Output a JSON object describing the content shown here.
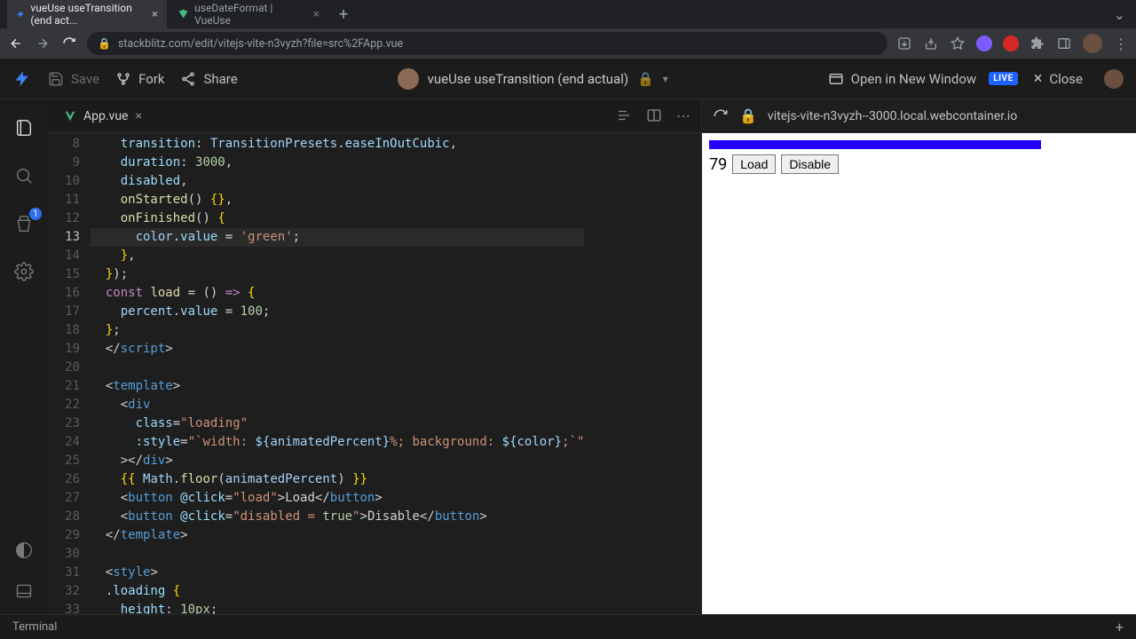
{
  "browser": {
    "tabs": [
      {
        "title": "vueUse useTransition (end act...",
        "active": true
      },
      {
        "title": "useDateFormat | VueUse",
        "active": false
      }
    ],
    "url": "stackblitz.com/edit/vitejs-vite-n3vyzh?file=src%2FApp.vue"
  },
  "app_bar": {
    "save": "Save",
    "fork": "Fork",
    "share": "Share",
    "project_title": "vueUse useTransition (end actual)",
    "open_new_window": "Open in New Window",
    "live": "LIVE",
    "close": "Close"
  },
  "activity": {
    "badge": "1"
  },
  "editor": {
    "filename": "App.vue",
    "line_start": 8,
    "line_end": 33,
    "highlight_line": 13,
    "lines": [
      {
        "n": 8,
        "segs": [
          [
            "    ",
            ""
          ],
          [
            "transition",
            "prop"
          ],
          [
            ": ",
            ""
          ],
          [
            "TransitionPresets",
            "var"
          ],
          [
            ".",
            ""
          ],
          [
            "easeInOutCubic",
            "prop"
          ],
          [
            ",",
            ""
          ]
        ]
      },
      {
        "n": 9,
        "segs": [
          [
            "    ",
            ""
          ],
          [
            "duration",
            "prop"
          ],
          [
            ": ",
            ""
          ],
          [
            "3000",
            "num"
          ],
          [
            ",",
            ""
          ]
        ]
      },
      {
        "n": 10,
        "segs": [
          [
            "    ",
            ""
          ],
          [
            "disabled",
            "prop"
          ],
          [
            ",",
            ""
          ]
        ]
      },
      {
        "n": 11,
        "segs": [
          [
            "    ",
            ""
          ],
          [
            "onStarted",
            "fn"
          ],
          [
            "() ",
            ""
          ],
          [
            "{}",
            "brace"
          ],
          [
            ",",
            ""
          ]
        ]
      },
      {
        "n": 12,
        "segs": [
          [
            "    ",
            ""
          ],
          [
            "onFinished",
            "fn"
          ],
          [
            "() ",
            ""
          ],
          [
            "{",
            "brace"
          ]
        ]
      },
      {
        "n": 13,
        "segs": [
          [
            "      ",
            ""
          ],
          [
            "color",
            "var"
          ],
          [
            ".",
            ""
          ],
          [
            "value",
            "prop"
          ],
          [
            " = ",
            ""
          ],
          [
            "'green'",
            "str"
          ],
          [
            ";",
            ""
          ]
        ]
      },
      {
        "n": 14,
        "segs": [
          [
            "    ",
            ""
          ],
          [
            "}",
            "brace"
          ],
          [
            ",",
            ""
          ]
        ]
      },
      {
        "n": 15,
        "segs": [
          [
            "  ",
            ""
          ],
          [
            "}",
            "brace"
          ],
          [
            ");",
            ""
          ]
        ]
      },
      {
        "n": 16,
        "segs": [
          [
            "  ",
            ""
          ],
          [
            "const",
            "kw"
          ],
          [
            " ",
            ""
          ],
          [
            "load",
            "fn"
          ],
          [
            " = () ",
            ""
          ],
          [
            "=>",
            "kw"
          ],
          [
            " ",
            ""
          ],
          [
            "{",
            "brace"
          ]
        ]
      },
      {
        "n": 17,
        "segs": [
          [
            "    ",
            ""
          ],
          [
            "percent",
            "var"
          ],
          [
            ".",
            ""
          ],
          [
            "value",
            "prop"
          ],
          [
            " = ",
            ""
          ],
          [
            "100",
            "num"
          ],
          [
            ";",
            ""
          ]
        ]
      },
      {
        "n": 18,
        "segs": [
          [
            "  ",
            ""
          ],
          [
            "}",
            "brace"
          ],
          [
            ";",
            ""
          ]
        ]
      },
      {
        "n": 19,
        "segs": [
          [
            "  ",
            ""
          ],
          [
            "</",
            "punc"
          ],
          [
            "script",
            "tag"
          ],
          [
            ">",
            "punc"
          ]
        ]
      },
      {
        "n": 20,
        "segs": [
          [
            "",
            ""
          ]
        ]
      },
      {
        "n": 21,
        "segs": [
          [
            "  ",
            ""
          ],
          [
            "<",
            "punc"
          ],
          [
            "template",
            "tag"
          ],
          [
            ">",
            "punc"
          ]
        ]
      },
      {
        "n": 22,
        "segs": [
          [
            "    ",
            ""
          ],
          [
            "<",
            "punc"
          ],
          [
            "div",
            "tag"
          ]
        ]
      },
      {
        "n": 23,
        "segs": [
          [
            "      ",
            ""
          ],
          [
            "class",
            "attr"
          ],
          [
            "=",
            ""
          ],
          [
            "\"loading\"",
            "str"
          ]
        ]
      },
      {
        "n": 24,
        "segs": [
          [
            "      ",
            ""
          ],
          [
            ":style",
            "attr"
          ],
          [
            "=",
            ""
          ],
          [
            "\"",
            "str"
          ],
          [
            "`width: ",
            "tpl"
          ],
          [
            "${",
            "interp"
          ],
          [
            "animatedPercent",
            "var"
          ],
          [
            "}",
            "interp"
          ],
          [
            "%; background: ",
            "tpl"
          ],
          [
            "${",
            "interp"
          ],
          [
            "color",
            "var"
          ],
          [
            "}",
            "interp"
          ],
          [
            ";`",
            "tpl"
          ],
          [
            "\"",
            "str"
          ]
        ]
      },
      {
        "n": 25,
        "segs": [
          [
            "    ",
            ""
          ],
          [
            "></",
            "punc"
          ],
          [
            "div",
            "tag"
          ],
          [
            ">",
            "punc"
          ]
        ]
      },
      {
        "n": 26,
        "segs": [
          [
            "    ",
            ""
          ],
          [
            "{{ ",
            "brace"
          ],
          [
            "Math",
            "var"
          ],
          [
            ".",
            ""
          ],
          [
            "floor",
            "fn"
          ],
          [
            "(",
            ""
          ],
          [
            "animatedPercent",
            "var"
          ],
          [
            ") ",
            ""
          ],
          [
            "}}",
            "brace"
          ]
        ]
      },
      {
        "n": 27,
        "segs": [
          [
            "    ",
            ""
          ],
          [
            "<",
            "punc"
          ],
          [
            "button",
            "tag"
          ],
          [
            " ",
            ""
          ],
          [
            "@click",
            "attr"
          ],
          [
            "=",
            ""
          ],
          [
            "\"load\"",
            "str"
          ],
          [
            ">",
            ""
          ],
          [
            "Load",
            ""
          ],
          [
            "</",
            "punc"
          ],
          [
            "button",
            "tag"
          ],
          [
            ">",
            "punc"
          ]
        ]
      },
      {
        "n": 28,
        "segs": [
          [
            "    ",
            ""
          ],
          [
            "<",
            "punc"
          ],
          [
            "button",
            "tag"
          ],
          [
            " ",
            ""
          ],
          [
            "@click",
            "attr"
          ],
          [
            "=",
            ""
          ],
          [
            "\"disabled = ",
            "str"
          ],
          [
            "true",
            "num"
          ],
          [
            "\"",
            "str"
          ],
          [
            ">",
            ""
          ],
          [
            "Disable",
            ""
          ],
          [
            "</",
            "punc"
          ],
          [
            "button",
            "tag"
          ],
          [
            ">",
            "punc"
          ]
        ]
      },
      {
        "n": 29,
        "segs": [
          [
            "  ",
            ""
          ],
          [
            "</",
            "punc"
          ],
          [
            "template",
            "tag"
          ],
          [
            ">",
            "punc"
          ]
        ]
      },
      {
        "n": 30,
        "segs": [
          [
            "",
            ""
          ]
        ]
      },
      {
        "n": 31,
        "segs": [
          [
            "  ",
            ""
          ],
          [
            "<",
            "punc"
          ],
          [
            "style",
            "tag"
          ],
          [
            ">",
            "punc"
          ]
        ]
      },
      {
        "n": 32,
        "segs": [
          [
            "  ",
            ""
          ],
          [
            ".loading",
            "attr"
          ],
          [
            " ",
            ""
          ],
          [
            "{",
            "brace"
          ]
        ]
      },
      {
        "n": 33,
        "segs": [
          [
            "    ",
            ""
          ],
          [
            "height",
            "prop"
          ],
          [
            ": ",
            ""
          ],
          [
            "10px",
            "num"
          ],
          [
            ";",
            ""
          ]
        ]
      }
    ]
  },
  "preview": {
    "url": "vitejs-vite-n3vyzh--3000.local.webcontainer.io",
    "percent": 79,
    "percent_text": "79",
    "bar_color": "#2300ff",
    "load_btn": "Load",
    "disable_btn": "Disable"
  },
  "footer": {
    "terminal": "Terminal"
  }
}
